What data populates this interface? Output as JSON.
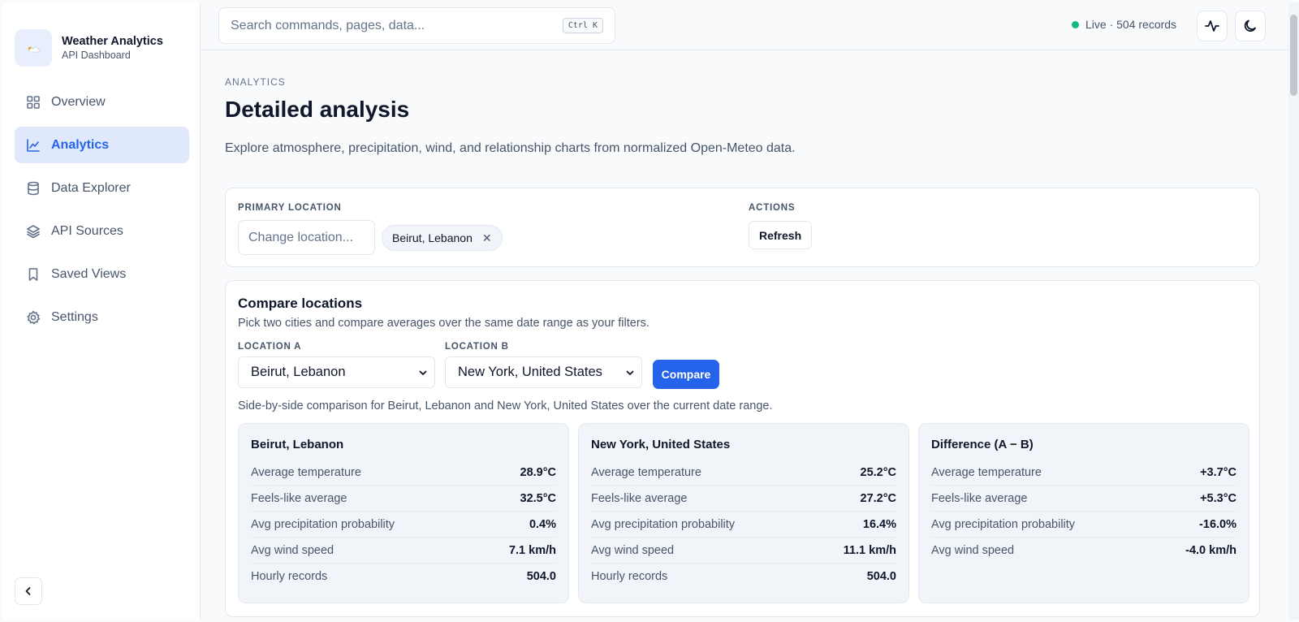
{
  "brand": {
    "title": "Weather Analytics",
    "subtitle": "API Dashboard"
  },
  "sidebar": {
    "items": [
      {
        "label": "Overview",
        "icon": "grid-icon",
        "active": false
      },
      {
        "label": "Analytics",
        "icon": "line-chart-icon",
        "active": true
      },
      {
        "label": "Data Explorer",
        "icon": "database-icon",
        "active": false
      },
      {
        "label": "API Sources",
        "icon": "layers-icon",
        "active": false
      },
      {
        "label": "Saved Views",
        "icon": "bookmark-icon",
        "active": false
      },
      {
        "label": "Settings",
        "icon": "gear-icon",
        "active": false
      }
    ]
  },
  "topbar": {
    "search_placeholder": "Search commands, pages, data...",
    "shortcut": "Ctrl K",
    "status": "Live · 504 records",
    "status_color": "#10b981"
  },
  "page": {
    "eyebrow": "ANALYTICS",
    "title": "Detailed analysis",
    "description": "Explore atmosphere, precipitation, wind, and relationship charts from normalized Open-Meteo data."
  },
  "filters": {
    "primary_label": "PRIMARY LOCATION",
    "location_placeholder": "Change location...",
    "selected_location": "Beirut, Lebanon",
    "actions_label": "ACTIONS",
    "refresh_label": "Refresh"
  },
  "compare": {
    "title": "Compare locations",
    "subtitle": "Pick two cities and compare averages over the same date range as your filters.",
    "location_a_label": "LOCATION A",
    "location_a_value": "Beirut, Lebanon",
    "location_b_label": "LOCATION B",
    "location_b_value": "New York, United States",
    "compare_label": "Compare",
    "summary": "Side-by-side comparison for Beirut, Lebanon and New York, United States over the current date range.",
    "accent": "#2563eb",
    "cards": [
      {
        "title": "Beirut, Lebanon",
        "rows": [
          {
            "label": "Average temperature",
            "value": "28.9°C"
          },
          {
            "label": "Feels-like average",
            "value": "32.5°C"
          },
          {
            "label": "Avg precipitation probability",
            "value": "0.4%"
          },
          {
            "label": "Avg wind speed",
            "value": "7.1 km/h"
          },
          {
            "label": "Hourly records",
            "value": "504.0"
          }
        ]
      },
      {
        "title": "New York, United States",
        "rows": [
          {
            "label": "Average temperature",
            "value": "25.2°C"
          },
          {
            "label": "Feels-like average",
            "value": "27.2°C"
          },
          {
            "label": "Avg precipitation probability",
            "value": "16.4%"
          },
          {
            "label": "Avg wind speed",
            "value": "11.1 km/h"
          },
          {
            "label": "Hourly records",
            "value": "504.0"
          }
        ]
      },
      {
        "title": "Difference (A − B)",
        "rows": [
          {
            "label": "Average temperature",
            "value": "+3.7°C"
          },
          {
            "label": "Feels-like average",
            "value": "+5.3°C"
          },
          {
            "label": "Avg precipitation probability",
            "value": "-16.0%"
          },
          {
            "label": "Avg wind speed",
            "value": "-4.0 km/h"
          }
        ]
      }
    ]
  }
}
